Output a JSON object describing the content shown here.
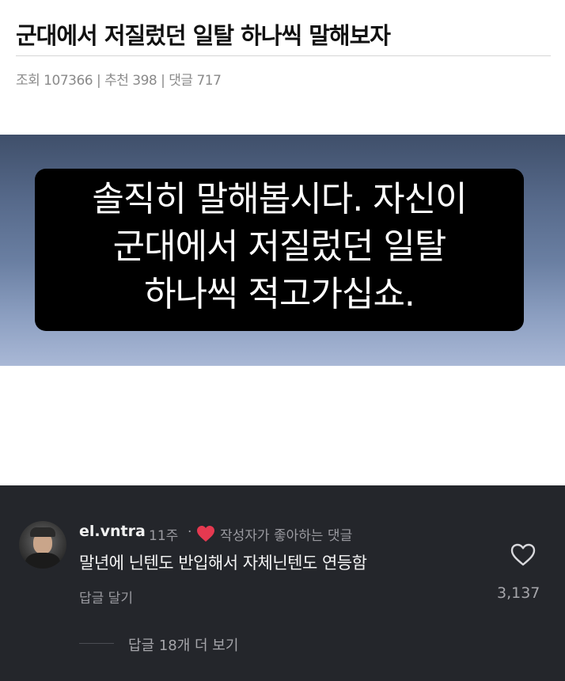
{
  "post": {
    "title": "군대에서 저질렀던 일탈 하나씩 말해보자",
    "meta": "조회 107366 | 추천 398 | 댓글 717"
  },
  "image_caption": {
    "line1": "솔직히 말해봅시다. 자신이",
    "line2": "군대에서 저질렀던 일탈",
    "line3": "하나씩 적고가십쇼."
  },
  "comment": {
    "username": "el.vntra",
    "time": "11주",
    "separator": "·",
    "liked_by_author": "작성자가 좋아하는 댓글",
    "text": "말년에 닌텐도 반입해서 자체닌텐도 연등함",
    "reply_label": "답글 달기",
    "like_count": "3,137",
    "more_replies": "답글 18개 더 보기"
  },
  "colors": {
    "comment_bg": "#24262b",
    "heart_red": "#e53950"
  }
}
